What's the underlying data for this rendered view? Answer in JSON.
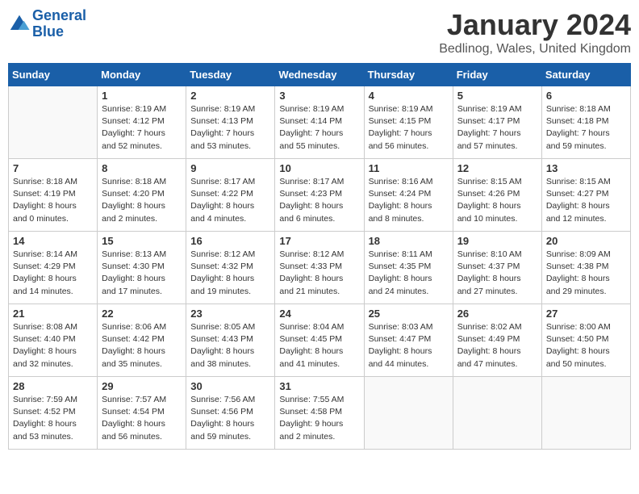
{
  "header": {
    "logo_line1": "General",
    "logo_line2": "Blue",
    "title": "January 2024",
    "subtitle": "Bedlinog, Wales, United Kingdom"
  },
  "days_of_week": [
    "Sunday",
    "Monday",
    "Tuesday",
    "Wednesday",
    "Thursday",
    "Friday",
    "Saturday"
  ],
  "weeks": [
    [
      {
        "day": "",
        "info": ""
      },
      {
        "day": "1",
        "info": "Sunrise: 8:19 AM\nSunset: 4:12 PM\nDaylight: 7 hours\nand 52 minutes."
      },
      {
        "day": "2",
        "info": "Sunrise: 8:19 AM\nSunset: 4:13 PM\nDaylight: 7 hours\nand 53 minutes."
      },
      {
        "day": "3",
        "info": "Sunrise: 8:19 AM\nSunset: 4:14 PM\nDaylight: 7 hours\nand 55 minutes."
      },
      {
        "day": "4",
        "info": "Sunrise: 8:19 AM\nSunset: 4:15 PM\nDaylight: 7 hours\nand 56 minutes."
      },
      {
        "day": "5",
        "info": "Sunrise: 8:19 AM\nSunset: 4:17 PM\nDaylight: 7 hours\nand 57 minutes."
      },
      {
        "day": "6",
        "info": "Sunrise: 8:18 AM\nSunset: 4:18 PM\nDaylight: 7 hours\nand 59 minutes."
      }
    ],
    [
      {
        "day": "7",
        "info": "Sunrise: 8:18 AM\nSunset: 4:19 PM\nDaylight: 8 hours\nand 0 minutes."
      },
      {
        "day": "8",
        "info": "Sunrise: 8:18 AM\nSunset: 4:20 PM\nDaylight: 8 hours\nand 2 minutes."
      },
      {
        "day": "9",
        "info": "Sunrise: 8:17 AM\nSunset: 4:22 PM\nDaylight: 8 hours\nand 4 minutes."
      },
      {
        "day": "10",
        "info": "Sunrise: 8:17 AM\nSunset: 4:23 PM\nDaylight: 8 hours\nand 6 minutes."
      },
      {
        "day": "11",
        "info": "Sunrise: 8:16 AM\nSunset: 4:24 PM\nDaylight: 8 hours\nand 8 minutes."
      },
      {
        "day": "12",
        "info": "Sunrise: 8:15 AM\nSunset: 4:26 PM\nDaylight: 8 hours\nand 10 minutes."
      },
      {
        "day": "13",
        "info": "Sunrise: 8:15 AM\nSunset: 4:27 PM\nDaylight: 8 hours\nand 12 minutes."
      }
    ],
    [
      {
        "day": "14",
        "info": "Sunrise: 8:14 AM\nSunset: 4:29 PM\nDaylight: 8 hours\nand 14 minutes."
      },
      {
        "day": "15",
        "info": "Sunrise: 8:13 AM\nSunset: 4:30 PM\nDaylight: 8 hours\nand 17 minutes."
      },
      {
        "day": "16",
        "info": "Sunrise: 8:12 AM\nSunset: 4:32 PM\nDaylight: 8 hours\nand 19 minutes."
      },
      {
        "day": "17",
        "info": "Sunrise: 8:12 AM\nSunset: 4:33 PM\nDaylight: 8 hours\nand 21 minutes."
      },
      {
        "day": "18",
        "info": "Sunrise: 8:11 AM\nSunset: 4:35 PM\nDaylight: 8 hours\nand 24 minutes."
      },
      {
        "day": "19",
        "info": "Sunrise: 8:10 AM\nSunset: 4:37 PM\nDaylight: 8 hours\nand 27 minutes."
      },
      {
        "day": "20",
        "info": "Sunrise: 8:09 AM\nSunset: 4:38 PM\nDaylight: 8 hours\nand 29 minutes."
      }
    ],
    [
      {
        "day": "21",
        "info": "Sunrise: 8:08 AM\nSunset: 4:40 PM\nDaylight: 8 hours\nand 32 minutes."
      },
      {
        "day": "22",
        "info": "Sunrise: 8:06 AM\nSunset: 4:42 PM\nDaylight: 8 hours\nand 35 minutes."
      },
      {
        "day": "23",
        "info": "Sunrise: 8:05 AM\nSunset: 4:43 PM\nDaylight: 8 hours\nand 38 minutes."
      },
      {
        "day": "24",
        "info": "Sunrise: 8:04 AM\nSunset: 4:45 PM\nDaylight: 8 hours\nand 41 minutes."
      },
      {
        "day": "25",
        "info": "Sunrise: 8:03 AM\nSunset: 4:47 PM\nDaylight: 8 hours\nand 44 minutes."
      },
      {
        "day": "26",
        "info": "Sunrise: 8:02 AM\nSunset: 4:49 PM\nDaylight: 8 hours\nand 47 minutes."
      },
      {
        "day": "27",
        "info": "Sunrise: 8:00 AM\nSunset: 4:50 PM\nDaylight: 8 hours\nand 50 minutes."
      }
    ],
    [
      {
        "day": "28",
        "info": "Sunrise: 7:59 AM\nSunset: 4:52 PM\nDaylight: 8 hours\nand 53 minutes."
      },
      {
        "day": "29",
        "info": "Sunrise: 7:57 AM\nSunset: 4:54 PM\nDaylight: 8 hours\nand 56 minutes."
      },
      {
        "day": "30",
        "info": "Sunrise: 7:56 AM\nSunset: 4:56 PM\nDaylight: 8 hours\nand 59 minutes."
      },
      {
        "day": "31",
        "info": "Sunrise: 7:55 AM\nSunset: 4:58 PM\nDaylight: 9 hours\nand 2 minutes."
      },
      {
        "day": "",
        "info": ""
      },
      {
        "day": "",
        "info": ""
      },
      {
        "day": "",
        "info": ""
      }
    ]
  ]
}
